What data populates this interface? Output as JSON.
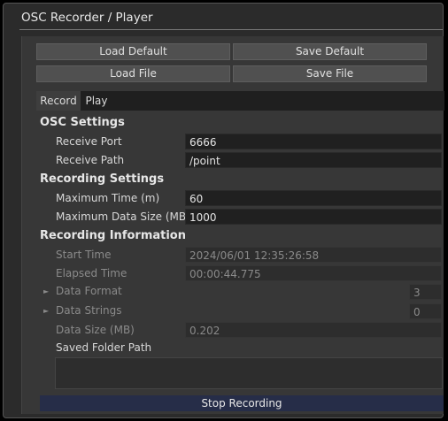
{
  "window": {
    "title": "OSC Recorder / Player"
  },
  "buttons": {
    "load_default": "Load Default",
    "save_default": "Save Default",
    "load_file": "Load File",
    "save_file": "Save File",
    "stop_recording": "Stop Recording"
  },
  "tabs": [
    {
      "label": "Record",
      "active": true
    },
    {
      "label": "Play",
      "active": false
    }
  ],
  "osc_settings": {
    "heading": "OSC Settings",
    "receive_port_label": "Receive Port",
    "receive_port": "6666",
    "receive_path_label": "Receive Path",
    "receive_path": "/point"
  },
  "recording_settings": {
    "heading": "Recording Settings",
    "max_time_label": "Maximum Time (m)",
    "max_time": "60",
    "max_size_label": "Maximum Data Size (MB)",
    "max_size": "1000"
  },
  "recording_info": {
    "heading": "Recording Information",
    "start_time_label": "Start Time",
    "start_time": "2024/06/01 12:35:26:58",
    "elapsed_time_label": "Elapsed Time",
    "elapsed_time": "00:00:44.775",
    "data_format_label": "Data Format",
    "data_format_count": "3",
    "data_strings_label": "Data Strings",
    "data_strings_count": "0",
    "data_size_label": "Data Size (MB)",
    "data_size": "0.202",
    "saved_folder_label": "Saved Folder Path",
    "saved_folder": ""
  },
  "icons": {
    "collapsed": "triangle-right-icon"
  },
  "colors": {
    "stop_button": "#262d48",
    "panel": "#373737",
    "field": "#202020"
  }
}
